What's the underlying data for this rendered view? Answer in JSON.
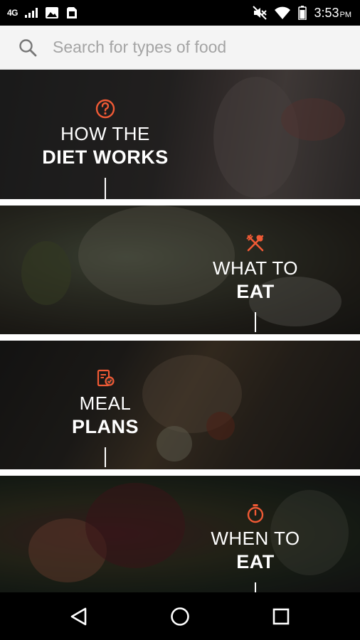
{
  "status_bar": {
    "network": "4G",
    "time": "3:53",
    "ampm": "PM"
  },
  "search": {
    "placeholder": "Search for types of food",
    "value": ""
  },
  "cards": [
    {
      "icon": "question-circle-icon",
      "line1": "HOW THE",
      "line2": "DIET WORKS"
    },
    {
      "icon": "fork-knife-icon",
      "line1": "WHAT TO",
      "line2": "EAT"
    },
    {
      "icon": "meal-plan-icon",
      "line1": "MEAL",
      "line2": "PLANS"
    },
    {
      "icon": "stopwatch-icon",
      "line1": "WHEN TO",
      "line2": "EAT"
    }
  ],
  "colors": {
    "accent": "#f05a35",
    "overlay": "#000000",
    "text": "#ffffff"
  },
  "nav": {
    "back": "back-icon",
    "home": "home-icon",
    "recents": "recents-icon"
  }
}
